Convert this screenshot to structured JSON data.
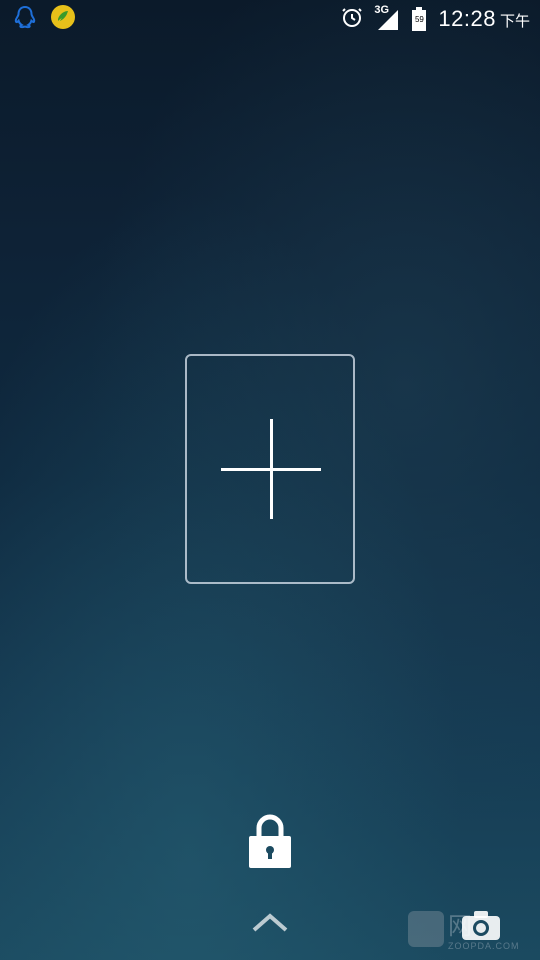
{
  "status_bar": {
    "time": "12:28",
    "ampm": "下午",
    "network": "3G",
    "battery_level": "59",
    "notifications": [
      "qq-icon",
      "app-icon"
    ],
    "right_icons": [
      "alarm-icon",
      "signal-icon",
      "battery-icon"
    ]
  },
  "lock_screen": {
    "add_widget_label": "",
    "unlock_icon": "lock-icon",
    "swipe_icon": "chevron-up-icon",
    "camera_icon": "camera-icon"
  },
  "watermark": {
    "top": "网",
    "bottom": "ZOOPDA.COM"
  },
  "colors": {
    "bg_top": "#0b1a2a",
    "bg_bottom": "#1b4a60",
    "icon_blue": "#1e6fd9",
    "icon_yellow": "#e7c01a",
    "white": "#ffffff"
  }
}
